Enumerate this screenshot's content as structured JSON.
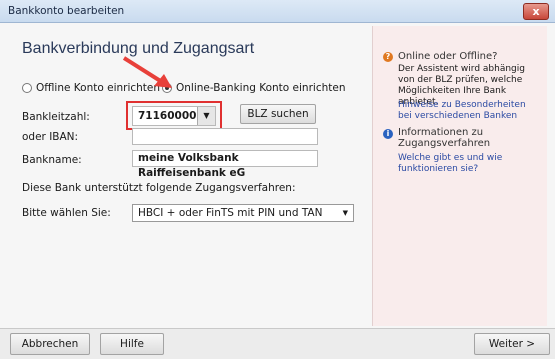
{
  "window": {
    "title": "Bankkonto bearbeiten",
    "close_glyph": "x"
  },
  "page": {
    "heading": "Bankverbindung und Zugangsart"
  },
  "account_type": {
    "offline_label": "Offline Konto einrichten",
    "online_label": "Online-Banking Konto einrichten",
    "selected": "online"
  },
  "form": {
    "blz_label": "Bankleitzahl:",
    "blz_value": "71160000",
    "blz_search_button": "BLZ suchen",
    "iban_label": "oder IBAN:",
    "iban_value": "",
    "bankname_label": "Bankname:",
    "bankname_value": "meine Volksbank Raiffeisenbank eG",
    "access_info": "Diese Bank unterstützt folgende Zugangsverfahren:",
    "choose_label": "Bitte wählen Sie:",
    "access_selected": "HBCI + oder FinTS mit PIN und TAN"
  },
  "sidebar": {
    "q_title": "Online oder Offline?",
    "q_text": "Der Assistent wird abhängig von der BLZ prüfen, welche Möglichkeiten Ihre Bank anbietet.",
    "q_link": "Hinweise zu Besonderheiten bei verschiedenen Banken",
    "info_title": "Informationen zu Zugangsverfahren",
    "info_link": "Welche gibt es und wie funktionieren sie?"
  },
  "footer": {
    "cancel": "Abbrechen",
    "help": "Hilfe",
    "next": "Weiter >"
  },
  "colors": {
    "highlight": "#e03030",
    "arrow": "#e8403a",
    "question_icon": "#e07820",
    "info_icon": "#2a62c0"
  }
}
